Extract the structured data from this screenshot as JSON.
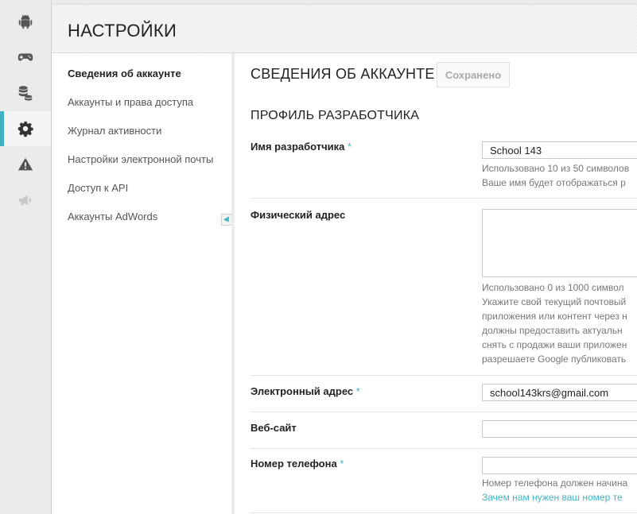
{
  "rail": {
    "items": [
      {
        "icon": "android-icon"
      },
      {
        "icon": "gamepad-icon"
      },
      {
        "icon": "database-icon"
      },
      {
        "icon": "gear-icon",
        "active": true
      },
      {
        "icon": "warning-icon"
      },
      {
        "icon": "megaphone-icon"
      }
    ]
  },
  "header": {
    "title": "НАСТРОЙКИ"
  },
  "subnav": {
    "items": [
      {
        "label": "Сведения об аккаунте",
        "active": true
      },
      {
        "label": "Аккаунты и права доступа"
      },
      {
        "label": "Журнал активности"
      },
      {
        "label": "Настройки электронной почты"
      },
      {
        "label": "Доступ к API"
      },
      {
        "label": "Аккаунты AdWords"
      }
    ]
  },
  "content": {
    "section_title": "СВЕДЕНИЯ ОБ АККАУНТЕ",
    "saved_label": "Сохранено",
    "profile_title": "ПРОФИЛЬ РАЗРАБОТЧИКА",
    "developer_name": {
      "label": "Имя разработчика",
      "required": "*",
      "value": "School 143",
      "help": [
        "Использовано 10 из 50 символов",
        "Ваше имя будет отображаться р"
      ]
    },
    "address": {
      "label": "Физический адрес",
      "value": "",
      "help": [
        "Использовано 0 из 1000 символ",
        "Укажите свой текущий почтовый",
        "приложения или контент через н",
        "должны предоставить актуальн",
        "снять с продажи ваши приложен",
        "разрешаете Google публиковать"
      ]
    },
    "email": {
      "label": "Электронный адрес",
      "required": "*",
      "value": "school143krs@gmail.com"
    },
    "website": {
      "label": "Веб-сайт",
      "value": ""
    },
    "phone": {
      "label": "Номер телефона",
      "required": "*",
      "value": "",
      "help": "Номер телефона должен начина",
      "link": "Зачем нам нужен ваш номер те"
    }
  },
  "colors": {
    "accent": "#3fb3c4"
  }
}
